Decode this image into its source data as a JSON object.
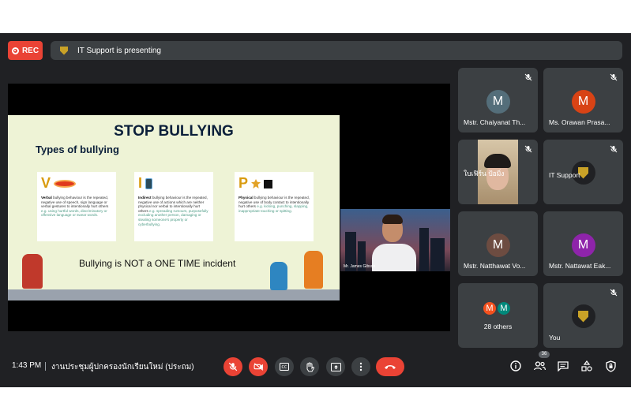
{
  "recording": {
    "label": "REC"
  },
  "presenting": {
    "text": "IT Support is presenting"
  },
  "slide": {
    "title": "STOP BULLYING",
    "subtitle": "Types of bullying",
    "cards": [
      {
        "letter": "V",
        "term": "Verbal",
        "body": " bullying behaviour is the repeated, negative use of speech, sign language or verbal gestures to intentionally hurt others ",
        "example": "e.g. using hurtful words, discriminatory or offensive language or swear words."
      },
      {
        "letter": "I",
        "term": "Indirect",
        "body": " bullying behaviour is the repeated, negative use of actions which are neither physical nor verbal to intentionally hurt others ",
        "example": "e.g. spreading rumours, purposefully excluding another person, damaging or stealing someone's property or cyberbullying."
      },
      {
        "letter": "P",
        "term": "Physical",
        "body": " bullying behaviour is the repeated, negative use of body contact to intentionally hurt others ",
        "example": "e.g. kicking, punching, slapping, inappropriate touching or spitting."
      }
    ],
    "tagline": "Bullying is NOT a ONE TIME incident"
  },
  "presenter": {
    "name": "Mr. James Gibson"
  },
  "participants": [
    {
      "name": "Mstr. Chaiyanat Th...",
      "initial": "M",
      "color": "#546e7a"
    },
    {
      "name": "Ms. Orawan Prasa...",
      "initial": "M",
      "color": "#d84315"
    },
    {
      "name": "ใบเฟิร์น ป้อมิ่ง",
      "initial": "",
      "color": ""
    },
    {
      "name": "IT Support",
      "initial": "",
      "color": ""
    },
    {
      "name": "Mstr. Natthawat Vo...",
      "initial": "M",
      "color": "#6d4c41"
    },
    {
      "name": "Mstr. Nattawat Eak...",
      "initial": "M",
      "color": "#8e24aa"
    },
    {
      "name": "You",
      "initial": "",
      "color": ""
    }
  ],
  "others": {
    "label": "28 others",
    "initials": [
      "M",
      "M"
    ],
    "colors": [
      "#f4511e",
      "#00897b"
    ]
  },
  "footer": {
    "time": "1:43 PM",
    "meeting_title": "งานประชุมผู้ปกครองนักเรียนใหม่ (ประถม)",
    "participant_count": "36"
  },
  "icons": [
    "mic-off-icon",
    "camera-off-icon",
    "captions-icon",
    "raise-hand-icon",
    "present-icon",
    "more-icon",
    "end-call-icon",
    "info-icon",
    "people-icon",
    "chat-icon",
    "activities-icon",
    "host-controls-icon"
  ]
}
